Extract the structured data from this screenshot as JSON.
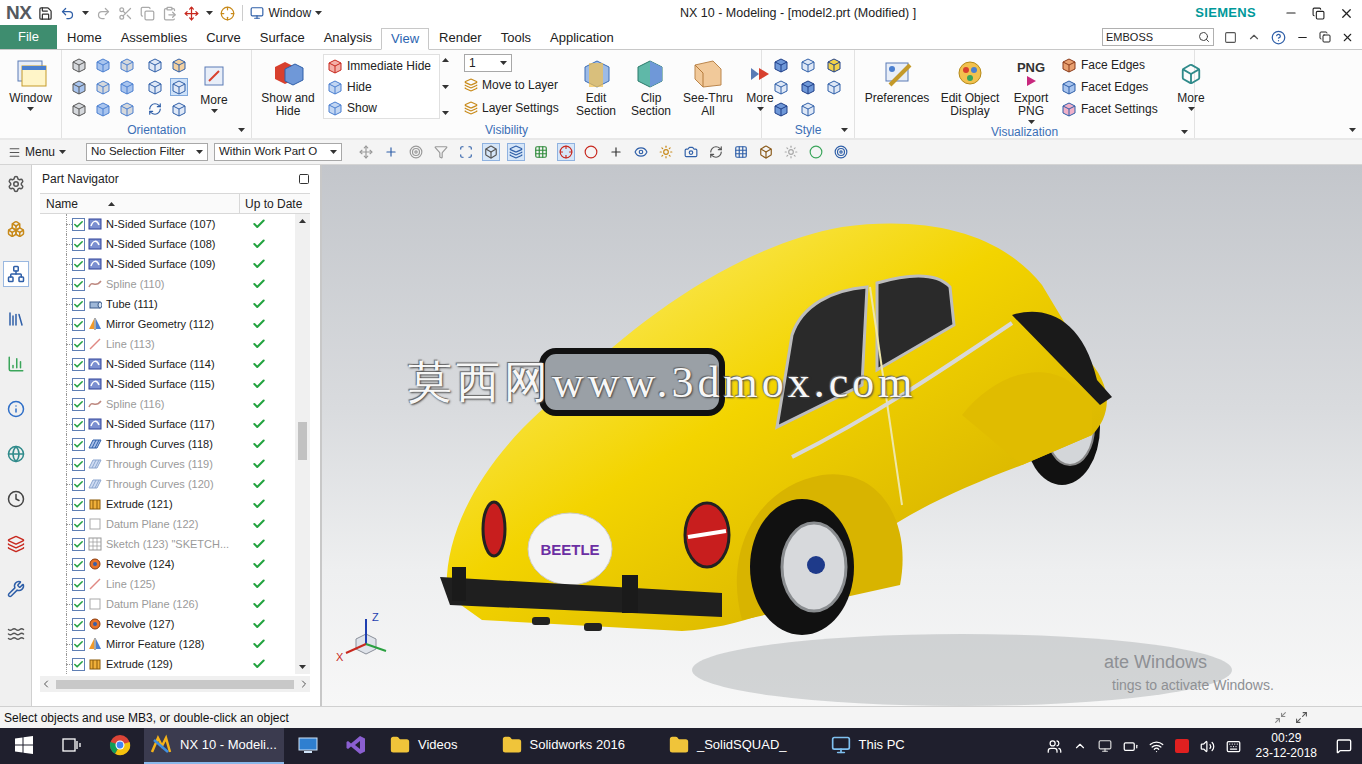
{
  "titlebar": {
    "logo": "NX",
    "window_menu": "Window",
    "title": "NX 10 - Modeling - [model2.prt (Modified) ]",
    "brand": "SIEMENS"
  },
  "tabs": [
    {
      "label": "File",
      "kind": "file",
      "selected": false
    },
    {
      "label": "Home",
      "kind": "tab",
      "selected": false
    },
    {
      "label": "Assemblies",
      "kind": "tab",
      "selected": false
    },
    {
      "label": "Curve",
      "kind": "tab",
      "selected": false
    },
    {
      "label": "Surface",
      "kind": "tab",
      "selected": false
    },
    {
      "label": "Analysis",
      "kind": "tab",
      "selected": false
    },
    {
      "label": "View",
      "kind": "tab",
      "selected": true
    },
    {
      "label": "Render",
      "kind": "tab",
      "selected": false
    },
    {
      "label": "Tools",
      "kind": "tab",
      "selected": false
    },
    {
      "label": "Application",
      "kind": "tab",
      "selected": false
    }
  ],
  "search": {
    "value": "EMBOSS"
  },
  "ribbon": {
    "window_button": "Window",
    "orientation": {
      "label": "Orientation",
      "more": "More"
    },
    "visibility": {
      "label": "Visibility",
      "show_hide": "Show and Hide",
      "items": [
        "Immediate Hide",
        "Hide",
        "Show"
      ],
      "layer": "1",
      "layer_items": [
        "Move to Layer",
        "Layer Settings"
      ],
      "buttons": [
        "Edit Section",
        "Clip Section",
        "See-Thru All",
        "More"
      ]
    },
    "style": {
      "label": "Style"
    },
    "visualization": {
      "label": "Visualization",
      "buttons": [
        "Preferences",
        "Edit Object Display"
      ],
      "export": {
        "badge": "PNG",
        "label": "Export PNG"
      },
      "items": [
        "Face Edges",
        "Facet Edges",
        "Facet Settings"
      ],
      "more": "More"
    }
  },
  "toolbar": {
    "menu": "Menu",
    "filter": "No Selection Filter",
    "scope": "Within Work Part O"
  },
  "navigator": {
    "title": "Part Navigator",
    "columns": [
      "Name",
      "Up to Date"
    ],
    "scroll": {
      "vertical": 0.45
    },
    "rows": [
      {
        "name": "N-Sided Surface (107)",
        "kind": "surface",
        "active": true,
        "checked": true,
        "up_to_date": true
      },
      {
        "name": "N-Sided Surface (108)",
        "kind": "surface",
        "active": true,
        "checked": true,
        "up_to_date": true
      },
      {
        "name": "N-Sided Surface (109)",
        "kind": "surface",
        "active": true,
        "checked": true,
        "up_to_date": true
      },
      {
        "name": "Spline (110)",
        "kind": "spline",
        "active": false,
        "checked": true,
        "up_to_date": true
      },
      {
        "name": "Tube (111)",
        "kind": "tube",
        "active": true,
        "checked": true,
        "up_to_date": true
      },
      {
        "name": "Mirror Geometry (112)",
        "kind": "mirror",
        "active": true,
        "checked": true,
        "up_to_date": true
      },
      {
        "name": "Line (113)",
        "kind": "line",
        "active": false,
        "checked": true,
        "up_to_date": true
      },
      {
        "name": "N-Sided Surface (114)",
        "kind": "surface",
        "active": true,
        "checked": true,
        "up_to_date": true
      },
      {
        "name": "N-Sided Surface (115)",
        "kind": "surface",
        "active": true,
        "checked": true,
        "up_to_date": true
      },
      {
        "name": "Spline (116)",
        "kind": "spline",
        "active": false,
        "checked": true,
        "up_to_date": true
      },
      {
        "name": "N-Sided Surface (117)",
        "kind": "surface",
        "active": true,
        "checked": true,
        "up_to_date": true
      },
      {
        "name": "Through Curves (118)",
        "kind": "curves",
        "active": true,
        "checked": true,
        "up_to_date": true
      },
      {
        "name": "Through Curves (119)",
        "kind": "curves",
        "active": false,
        "checked": true,
        "up_to_date": true
      },
      {
        "name": "Through Curves (120)",
        "kind": "curves",
        "active": false,
        "checked": true,
        "up_to_date": true
      },
      {
        "name": "Extrude (121)",
        "kind": "extrude",
        "active": true,
        "checked": true,
        "up_to_date": true
      },
      {
        "name": "Datum Plane (122)",
        "kind": "datum",
        "active": false,
        "checked": true,
        "up_to_date": true
      },
      {
        "name": "Sketch (123) \"SKETCH...",
        "kind": "sketch",
        "active": false,
        "checked": true,
        "up_to_date": true
      },
      {
        "name": "Revolve (124)",
        "kind": "revolve",
        "active": true,
        "checked": true,
        "up_to_date": true
      },
      {
        "name": "Line (125)",
        "kind": "line",
        "active": false,
        "checked": true,
        "up_to_date": true
      },
      {
        "name": "Datum Plane (126)",
        "kind": "datum",
        "active": false,
        "checked": true,
        "up_to_date": true
      },
      {
        "name": "Revolve (127)",
        "kind": "revolve",
        "active": true,
        "checked": true,
        "up_to_date": true
      },
      {
        "name": "Mirror Feature (128)",
        "kind": "mirror",
        "active": true,
        "checked": true,
        "up_to_date": true
      },
      {
        "name": "Extrude (129)",
        "kind": "extrude",
        "active": true,
        "checked": true,
        "up_to_date": true
      }
    ]
  },
  "viewport": {
    "watermark": "莫西网www.3dmox.com",
    "plate": "BEETLE",
    "axes": {
      "z": "Z",
      "x": "X"
    },
    "activation": [
      "ate Windows",
      "tings to activate Windows."
    ]
  },
  "status_bar": "Select objects and use MB3, or double-click an object",
  "taskbar": {
    "items": [
      {
        "kind": "start",
        "label": "",
        "selected": false
      },
      {
        "kind": "taskview",
        "label": "",
        "selected": false
      },
      {
        "kind": "chrome",
        "label": "",
        "selected": false
      },
      {
        "kind": "nx",
        "label": "NX 10 - Modeli...",
        "selected": true
      },
      {
        "kind": "app",
        "label": "",
        "selected": false
      },
      {
        "kind": "vs",
        "label": "",
        "selected": false
      },
      {
        "kind": "folder",
        "label": "Videos",
        "selected": false
      },
      {
        "kind": "folder",
        "label": "Solidworks 2016",
        "selected": false
      },
      {
        "kind": "folder",
        "label": "_SolidSQUAD_",
        "selected": false
      },
      {
        "kind": "pc",
        "label": "This PC",
        "selected": false
      }
    ],
    "time": "00:29",
    "date": "23-12-2018"
  }
}
